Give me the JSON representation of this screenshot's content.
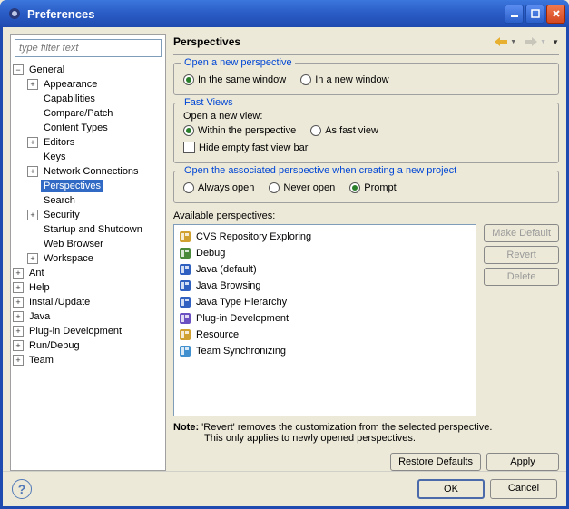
{
  "window": {
    "title": "Preferences"
  },
  "filter": {
    "placeholder": "type filter text"
  },
  "tree": {
    "items": [
      {
        "label": "General",
        "expander": "−",
        "indent": 0,
        "children": [
          {
            "label": "Appearance",
            "expander": "+"
          },
          {
            "label": "Capabilities"
          },
          {
            "label": "Compare/Patch"
          },
          {
            "label": "Content Types"
          },
          {
            "label": "Editors",
            "expander": "+"
          },
          {
            "label": "Keys"
          },
          {
            "label": "Network Connections",
            "expander": "+"
          },
          {
            "label": "Perspectives",
            "selected": true
          },
          {
            "label": "Search"
          },
          {
            "label": "Security",
            "expander": "+"
          },
          {
            "label": "Startup and Shutdown"
          },
          {
            "label": "Web Browser"
          },
          {
            "label": "Workspace",
            "expander": "+"
          }
        ]
      },
      {
        "label": "Ant",
        "expander": "+"
      },
      {
        "label": "Help",
        "expander": "+"
      },
      {
        "label": "Install/Update",
        "expander": "+"
      },
      {
        "label": "Java",
        "expander": "+"
      },
      {
        "label": "Plug-in Development",
        "expander": "+"
      },
      {
        "label": "Run/Debug",
        "expander": "+"
      },
      {
        "label": "Team",
        "expander": "+"
      }
    ]
  },
  "page": {
    "title": "Perspectives",
    "group1": {
      "title": "Open a new perspective",
      "r1": "In the same window",
      "r2": "In a new window"
    },
    "group2": {
      "title": "Fast Views",
      "sub": "Open a new view:",
      "r1": "Within the perspective",
      "r2": "As fast view",
      "chk": "Hide empty fast view bar"
    },
    "group3": {
      "title": "Open the associated perspective when creating a new project",
      "r1": "Always open",
      "r2": "Never open",
      "r3": "Prompt"
    },
    "availLabel": "Available perspectives:",
    "persp": [
      {
        "label": "CVS Repository Exploring",
        "color": "#d0a030"
      },
      {
        "label": "Debug",
        "color": "#4a8a3a"
      },
      {
        "label": "Java (default)",
        "color": "#3060c0"
      },
      {
        "label": "Java Browsing",
        "color": "#3060c0"
      },
      {
        "label": "Java Type Hierarchy",
        "color": "#3060c0"
      },
      {
        "label": "Plug-in Development",
        "color": "#6a50c0"
      },
      {
        "label": "Resource",
        "color": "#d0a030"
      },
      {
        "label": "Team Synchronizing",
        "color": "#4090d0"
      }
    ],
    "btns": {
      "makeDefault": "Make Default",
      "revert": "Revert",
      "delete": "Delete"
    },
    "noteLabel": "Note:",
    "note1": "'Revert' removes the customization from the selected perspective.",
    "note2": "This only applies to newly opened perspectives.",
    "restore": "Restore Defaults",
    "apply": "Apply"
  },
  "footer": {
    "ok": "OK",
    "cancel": "Cancel"
  }
}
